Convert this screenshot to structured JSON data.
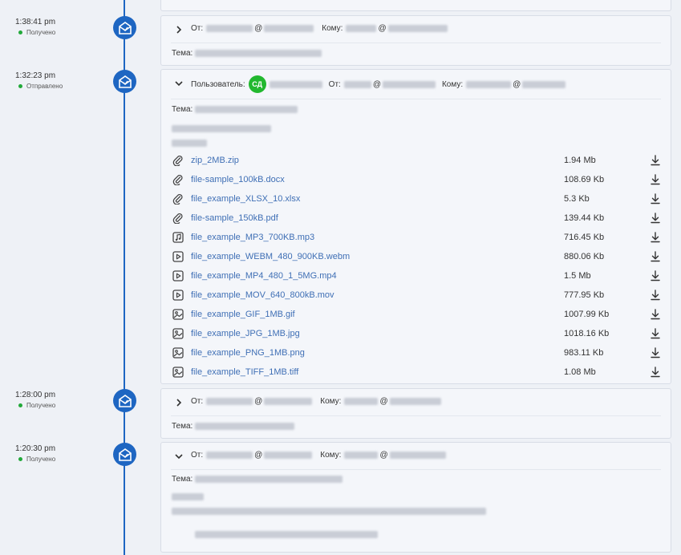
{
  "labels": {
    "from": "От:",
    "to": "Кому:",
    "subject": "Тема:",
    "user": "Пользователь:",
    "at": "@"
  },
  "entries": [
    {
      "time": "1:38:41 pm",
      "status": "Получено"
    },
    {
      "time": "1:32:23 pm",
      "status": "Отправлено",
      "user_initials": "СД"
    },
    {
      "time": "1:28:00 pm",
      "status": "Получено"
    },
    {
      "time": "1:20:30 pm",
      "status": "Получено"
    }
  ],
  "attachments": [
    {
      "name": "zip_2MB.zip",
      "size": "1.94 Mb",
      "icon": "paperclip-icon"
    },
    {
      "name": "file-sample_100kB.docx",
      "size": "108.69 Kb",
      "icon": "paperclip-icon"
    },
    {
      "name": "file_example_XLSX_10.xlsx",
      "size": "5.3 Kb",
      "icon": "paperclip-icon"
    },
    {
      "name": "file-sample_150kB.pdf",
      "size": "139.44 Kb",
      "icon": "paperclip-icon"
    },
    {
      "name": "file_example_MP3_700KB.mp3",
      "size": "716.45 Kb",
      "icon": "music-icon"
    },
    {
      "name": "file_example_WEBM_480_900KB.webm",
      "size": "880.06 Kb",
      "icon": "video-icon"
    },
    {
      "name": "file_example_MP4_480_1_5MG.mp4",
      "size": "1.5 Mb",
      "icon": "video-icon"
    },
    {
      "name": "file_example_MOV_640_800kB.mov",
      "size": "777.95 Kb",
      "icon": "video-icon"
    },
    {
      "name": "file_example_GIF_1MB.gif",
      "size": "1007.99 Kb",
      "icon": "image-icon"
    },
    {
      "name": "file_example_JPG_1MB.jpg",
      "size": "1018.16 Kb",
      "icon": "image-icon"
    },
    {
      "name": "file_example_PNG_1MB.png",
      "size": "983.11 Kb",
      "icon": "image-icon"
    },
    {
      "name": "file_example_TIFF_1MB.tiff",
      "size": "1.08 Mb",
      "icon": "image-icon"
    }
  ],
  "colors": {
    "accent": "#1e66c2",
    "link": "#3f6fb5",
    "status_dot": "#22a93a",
    "avatar": "#22b82f"
  }
}
